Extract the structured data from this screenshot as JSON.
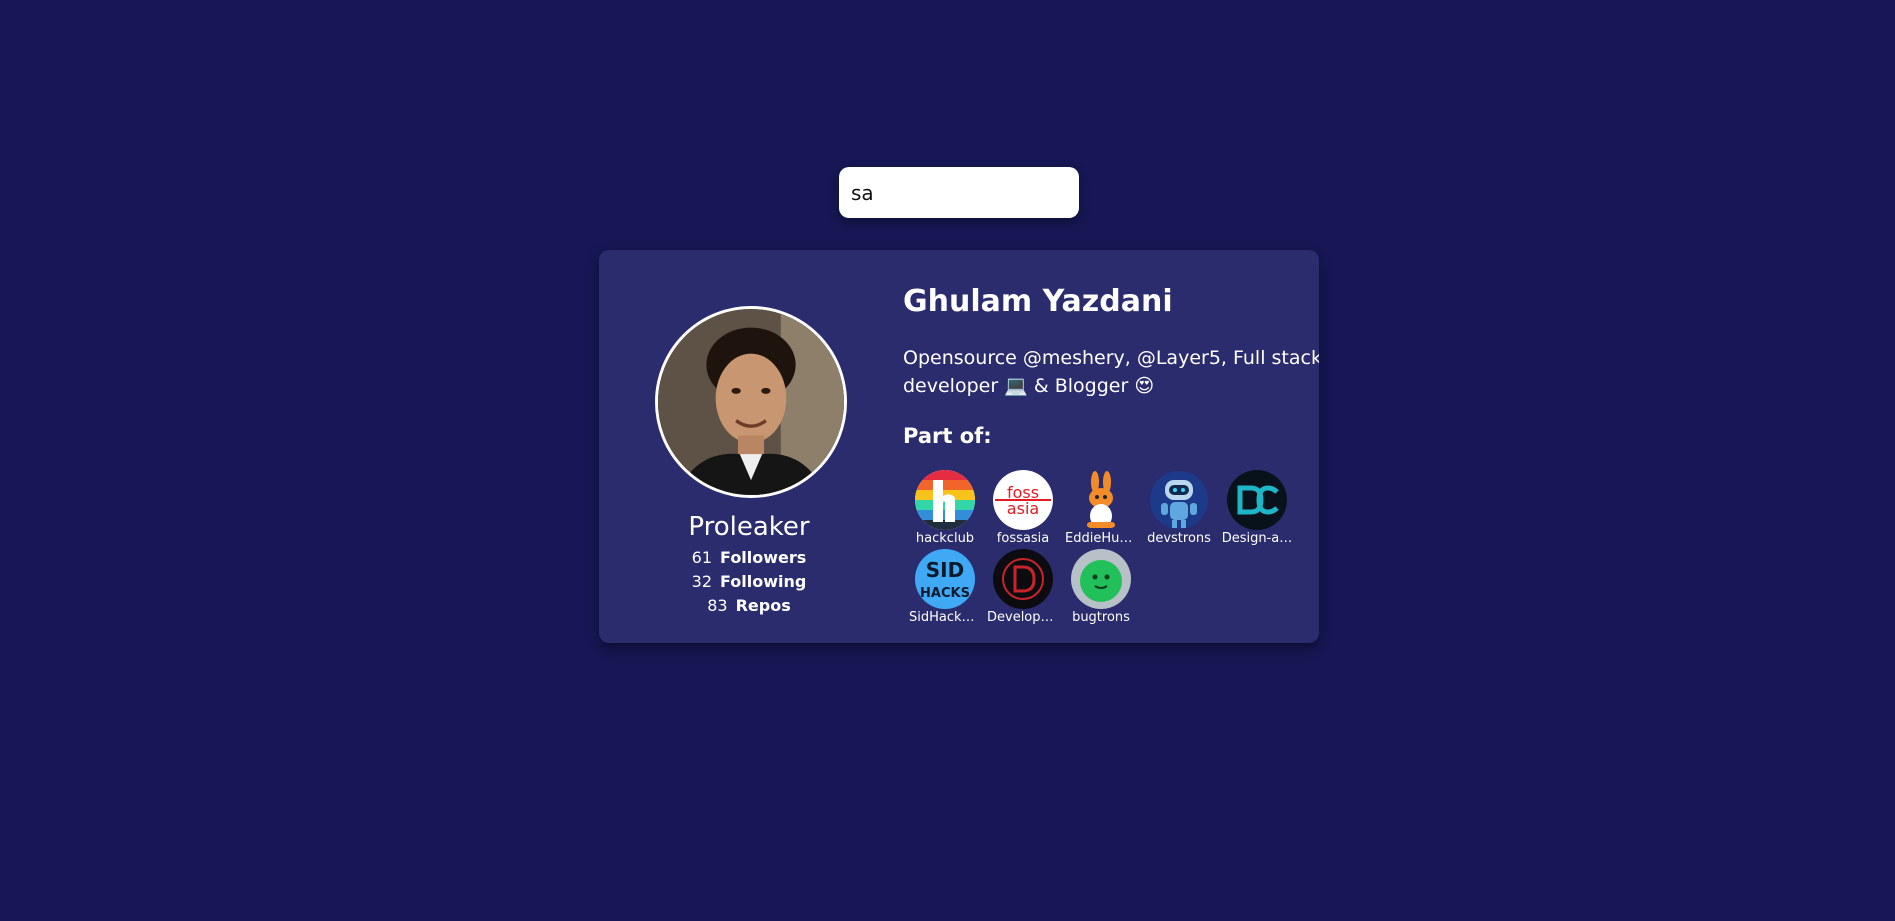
{
  "search": {
    "value": "sa"
  },
  "profile": {
    "name": "Ghulam Yazdani",
    "username": "Proleaker",
    "bio": "Opensource @meshery, @Layer5, Full stack developer 💻 & Blogger 😍",
    "part_of_label": "Part of:",
    "stats": [
      {
        "value": "61",
        "label": "Followers"
      },
      {
        "value": "32",
        "label": "Following"
      },
      {
        "value": "83",
        "label": "Repos"
      }
    ]
  },
  "orgs": [
    {
      "name": "hackclub",
      "icon": "hackclub-logo-icon"
    },
    {
      "name": "fossasia",
      "icon": "fossasia-logo-icon"
    },
    {
      "name": "EddieHub…",
      "icon": "eddiehub-logo-icon"
    },
    {
      "name": "devstrons",
      "icon": "devstrons-logo-icon"
    },
    {
      "name": "Design-a…",
      "icon": "design-and-code-logo-icon"
    },
    {
      "name": "SidHacks…",
      "icon": "sidhacks-logo-icon"
    },
    {
      "name": "Develope…",
      "icon": "developer-logo-icon"
    },
    {
      "name": "bugtrons",
      "icon": "bugtrons-logo-icon"
    }
  ],
  "colors": {
    "background": "#161754",
    "card": "#2a2c6e",
    "text": "#ffffff"
  }
}
